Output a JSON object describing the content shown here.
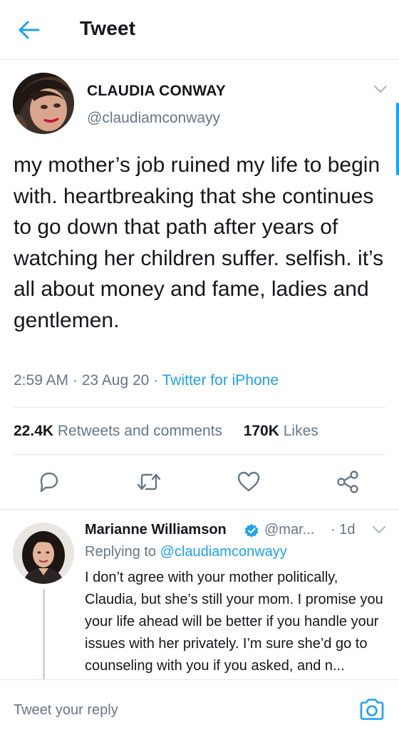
{
  "header": {
    "title": "Tweet",
    "back_icon": "arrow-left-icon"
  },
  "tweet": {
    "author_name": "CLAUDIA CONWAY",
    "author_handle": "@claudiamconwayy",
    "text": "my mother’s job ruined my life to begin with. heartbreaking that she continues to go down that path after years of watching her children suffer. selfish. it’s all about money and fame, ladies and gentlemen.",
    "time": "2:59 AM",
    "date": "23 Aug 20",
    "source": "Twitter for iPhone",
    "retweets_count": "22.4K",
    "retweets_label": "Retweets and comments",
    "likes_count": "170K",
    "likes_label": "Likes"
  },
  "actions": [
    {
      "name": "reply",
      "icon": "reply-icon"
    },
    {
      "name": "retweet",
      "icon": "retweet-icon"
    },
    {
      "name": "like",
      "icon": "heart-icon"
    },
    {
      "name": "share",
      "icon": "share-icon"
    }
  ],
  "reply": {
    "author_name": "Marianne Williamson",
    "verified": true,
    "handle": "@mar...",
    "time": "1d",
    "replying_to_label": "Replying to",
    "replying_to_handle": "@claudiamconwayy",
    "text": "I don’t agree with your mother politically, Claudia, but she’s still your mom. I promise you your life ahead will be better if you handle your issues with her privately. I’m sure she’d go to counseling with you if you asked, and n..."
  },
  "composer": {
    "placeholder": "Tweet your reply",
    "camera_icon": "camera-icon"
  },
  "colors": {
    "accent": "#1da1f2",
    "text_primary": "#14171a",
    "text_secondary": "#657786",
    "divider": "#e1e8ed"
  }
}
